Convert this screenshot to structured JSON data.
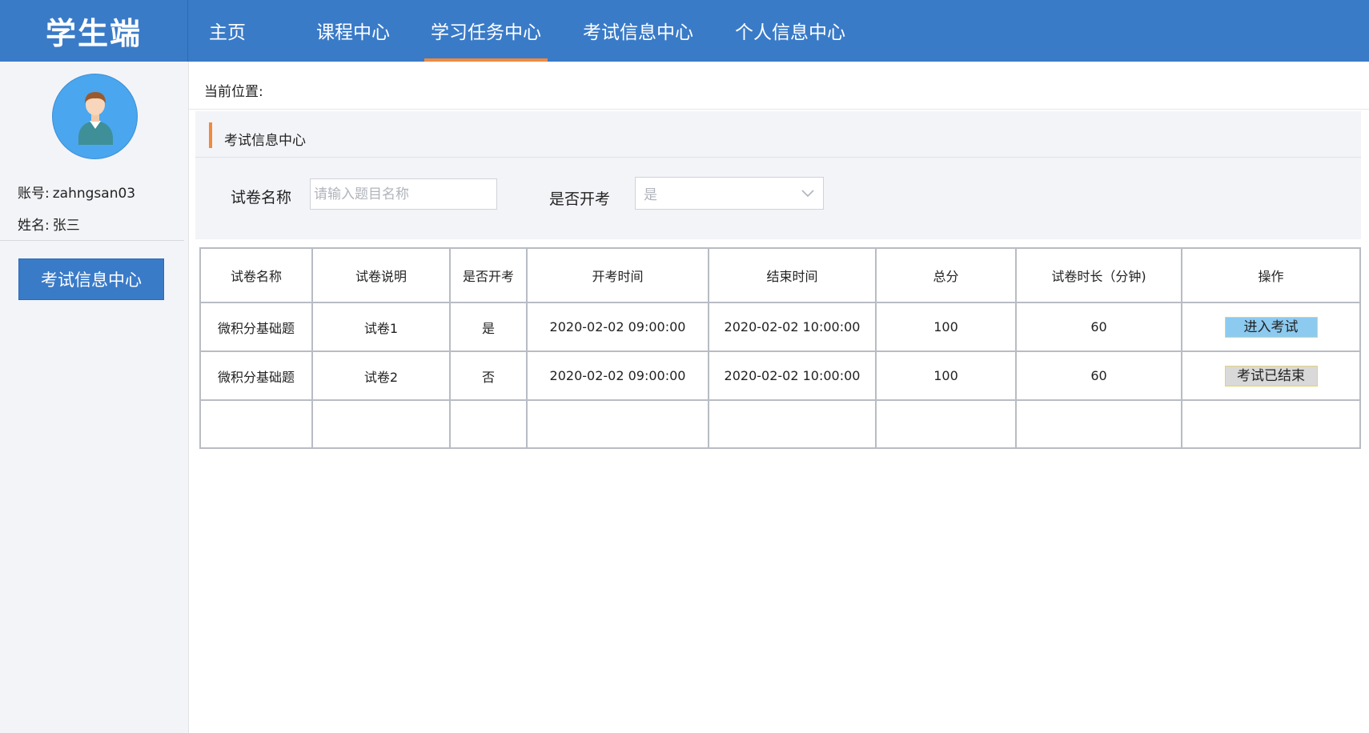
{
  "app": {
    "brand": "学生端"
  },
  "nav": {
    "items": [
      {
        "label": "主页"
      },
      {
        "label": "课程中心"
      },
      {
        "label": "学习任务中心",
        "active": true
      },
      {
        "label": "考试信息中心"
      },
      {
        "label": "个人信息中心"
      }
    ]
  },
  "user": {
    "account_label": "账号:",
    "account_value": "zahngsan03",
    "name_label": "姓名:",
    "name_value": "张三",
    "avatar_icon": "user-avatar-icon"
  },
  "sidebar": {
    "button_label": "考试信息中心"
  },
  "breadcrumb": {
    "label": "当前位置:"
  },
  "panel": {
    "title": "考试信息中心"
  },
  "filters": {
    "name_label": "试卷名称",
    "name_placeholder": "请输入题目名称",
    "name_value": "",
    "open_label": "是否开考",
    "open_selected": "是"
  },
  "table": {
    "headers": [
      "试卷名称",
      "试卷说明",
      "是否开考",
      "开考时间",
      "结束时间",
      "总分",
      "试卷时长（分钟)",
      "操作"
    ],
    "rows": [
      {
        "name": "微积分基础题",
        "desc": "试卷1",
        "open": "是",
        "start": "2020-02-02 09:00:00",
        "end": "2020-02-02 10:00:00",
        "score": "100",
        "duration": "60",
        "action": "进入考试"
      },
      {
        "name": "微积分基础题",
        "desc": "试卷2",
        "open": "否",
        "start": "2020-02-02 09:00:00",
        "end": "2020-02-02 10:00:00",
        "score": "100",
        "duration": "60",
        "action": "考试已结束"
      }
    ]
  },
  "colors": {
    "header_blue": "#3a7bc8",
    "accent_orange": "#f08a3c",
    "sidebar_bg": "#f3f4f8",
    "enter_button": "#8ccaf0",
    "ended_button": "#d9d9d9"
  }
}
